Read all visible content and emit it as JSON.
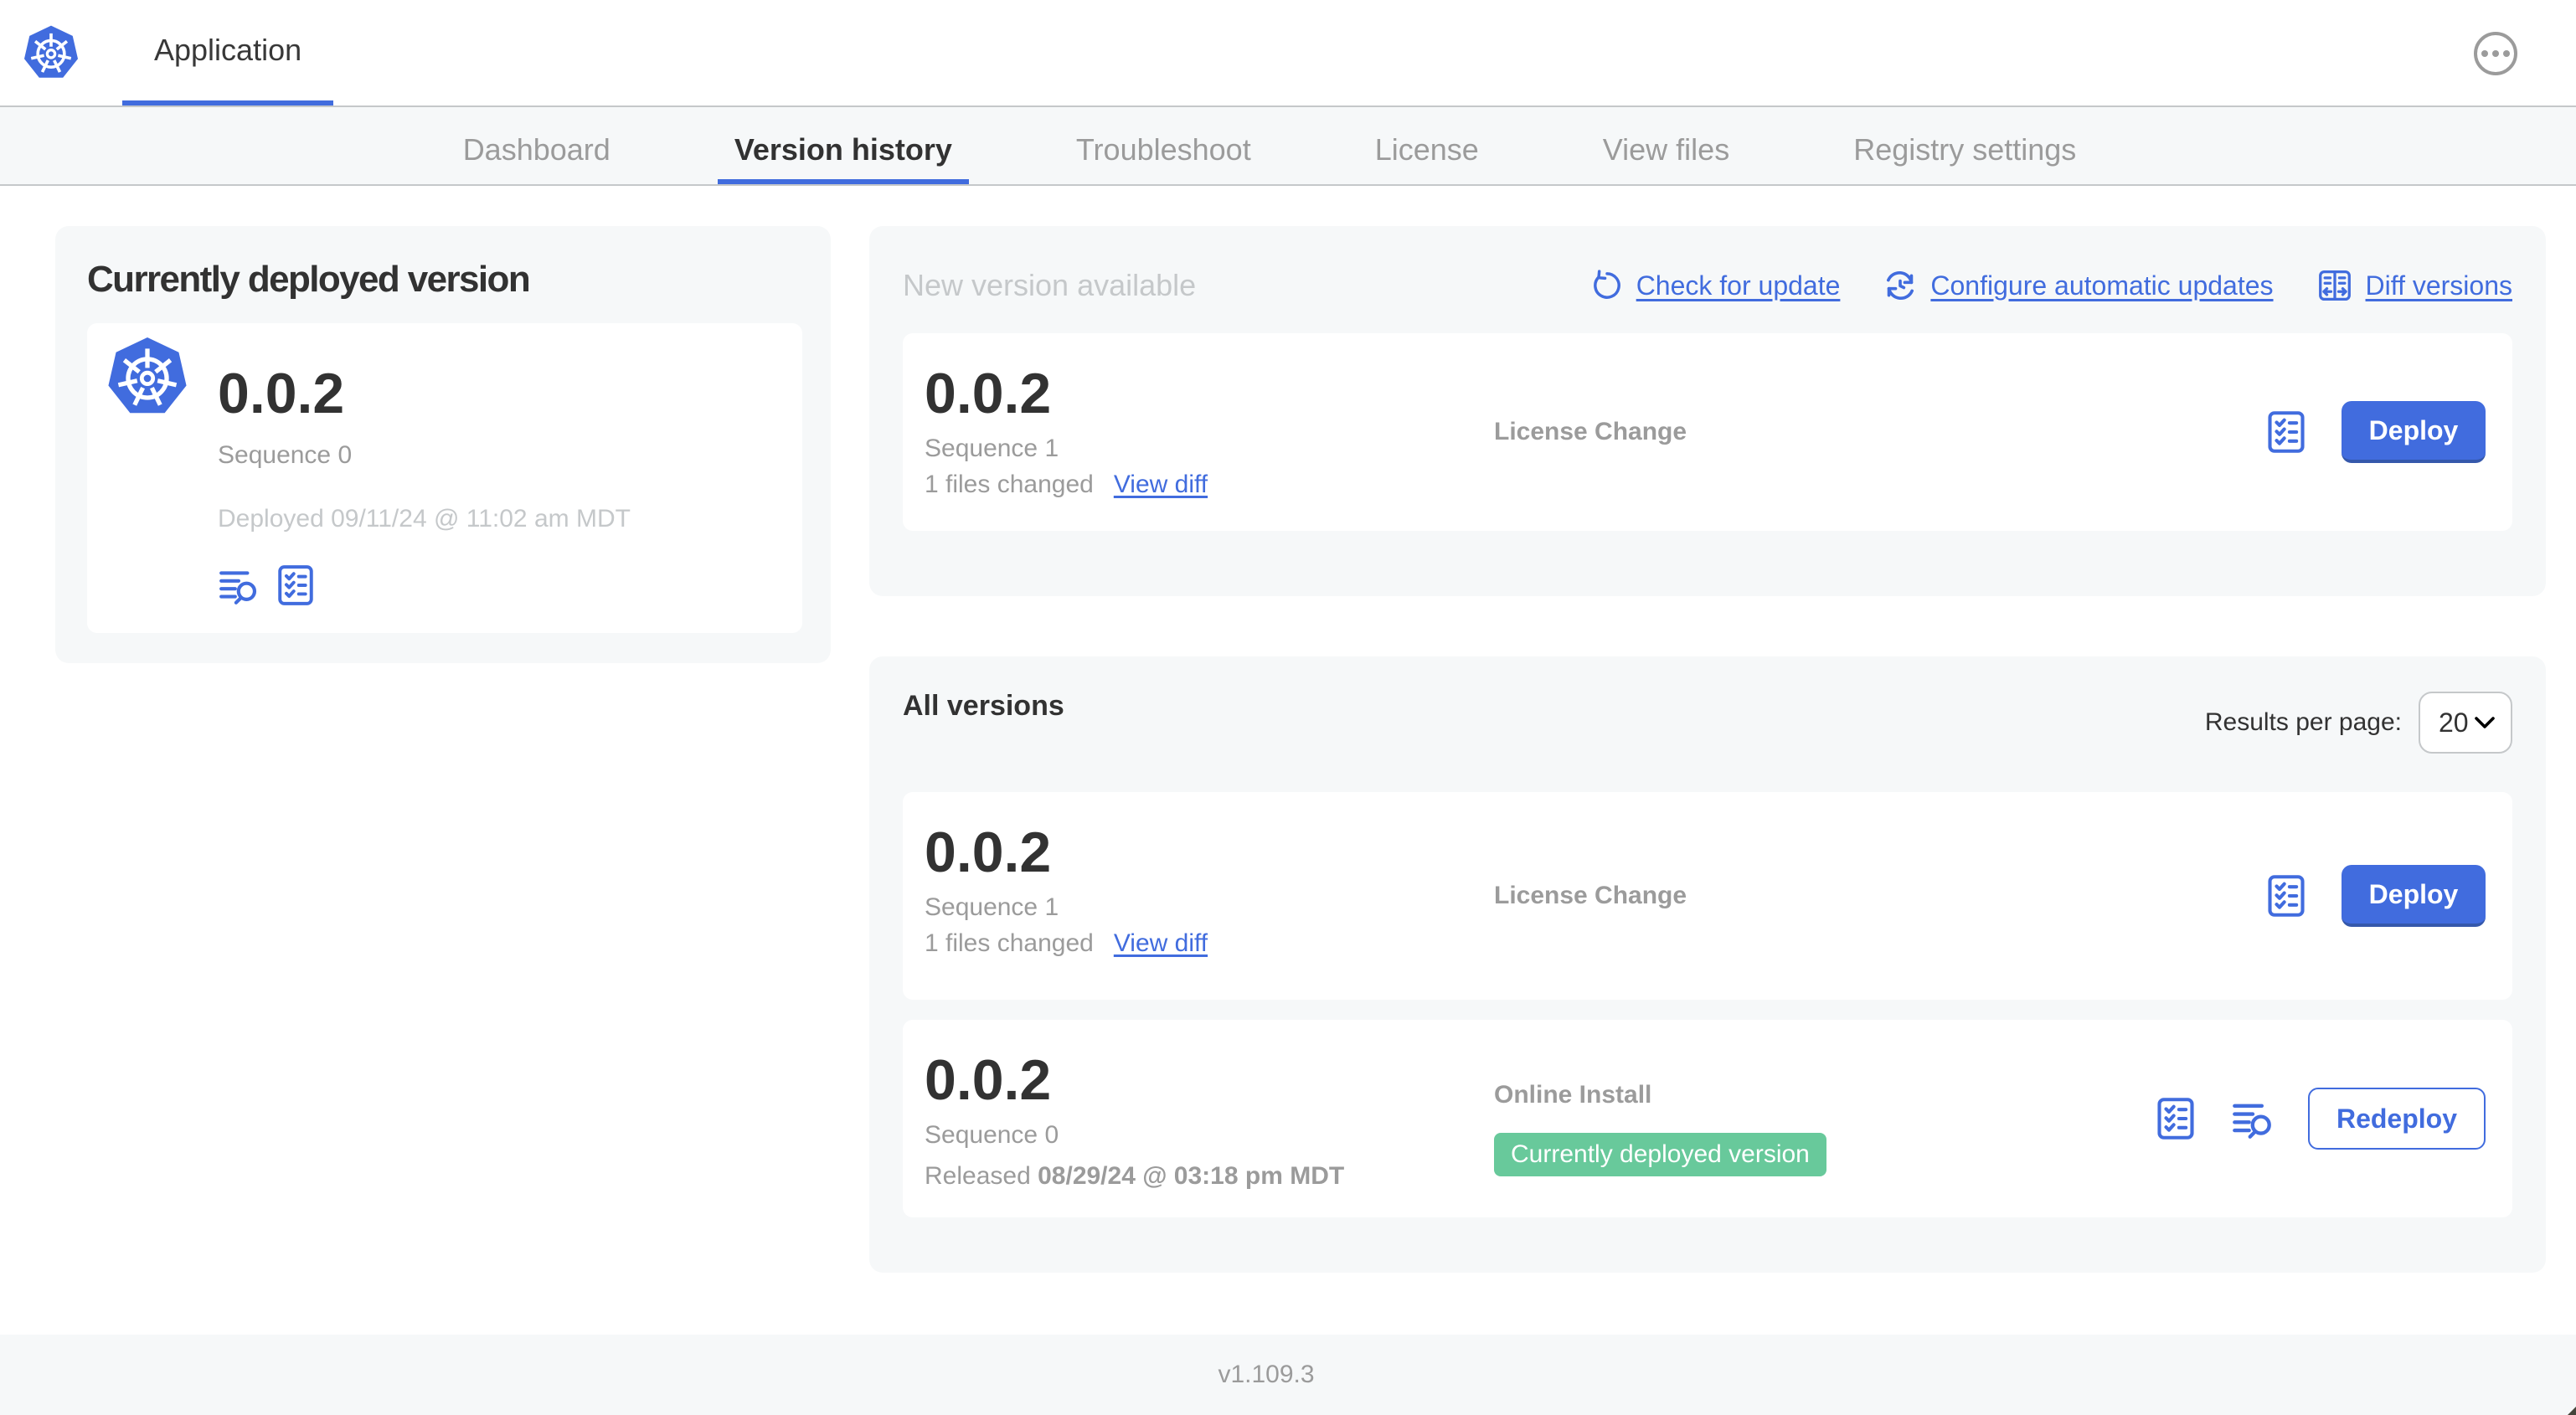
{
  "header": {
    "app_name": "Application"
  },
  "tabs": [
    {
      "label": "Dashboard"
    },
    {
      "label": "Version history"
    },
    {
      "label": "Troubleshoot"
    },
    {
      "label": "License"
    },
    {
      "label": "View files"
    },
    {
      "label": "Registry settings"
    }
  ],
  "current_version_card": {
    "title": "Currently deployed version",
    "version": "0.0.2",
    "sequence": "Sequence 0",
    "deployed_at": "Deployed 09/11/24 @ 11:02 am MDT"
  },
  "new_version_card": {
    "title": "New version available",
    "actions": {
      "check_for_update": "Check for update",
      "configure_automatic_updates": "Configure automatic updates",
      "diff_versions": "Diff versions"
    },
    "row": {
      "version": "0.0.2",
      "sequence": "Sequence 1",
      "files_changed": "1 files changed",
      "view_diff": "View diff",
      "source": "License Change",
      "deploy_label": "Deploy"
    }
  },
  "all_versions_card": {
    "title": "All versions",
    "results_per_page_label": "Results per page:",
    "results_per_page_value": "20",
    "rows": [
      {
        "version": "0.0.2",
        "sequence": "Sequence 1",
        "files_changed": "1 files changed",
        "view_diff": "View diff",
        "source": "License Change",
        "action_label": "Deploy"
      },
      {
        "version": "0.0.2",
        "sequence": "Sequence 0",
        "released_prefix": "Released",
        "released_date": "08/29/24 @ 03:18 pm MDT",
        "source": "Online Install",
        "badge": "Currently deployed version",
        "action_label": "Redeploy"
      }
    ]
  },
  "footer": {
    "app_version": "v1.109.3"
  },
  "colors": {
    "accent_blue": "#416cde",
    "badge_green": "#68c99b",
    "card_bg": "#f6f8f9",
    "text_dark": "#323232",
    "text_muted": "#9b9b9b",
    "text_light": "#c5c8ca"
  }
}
